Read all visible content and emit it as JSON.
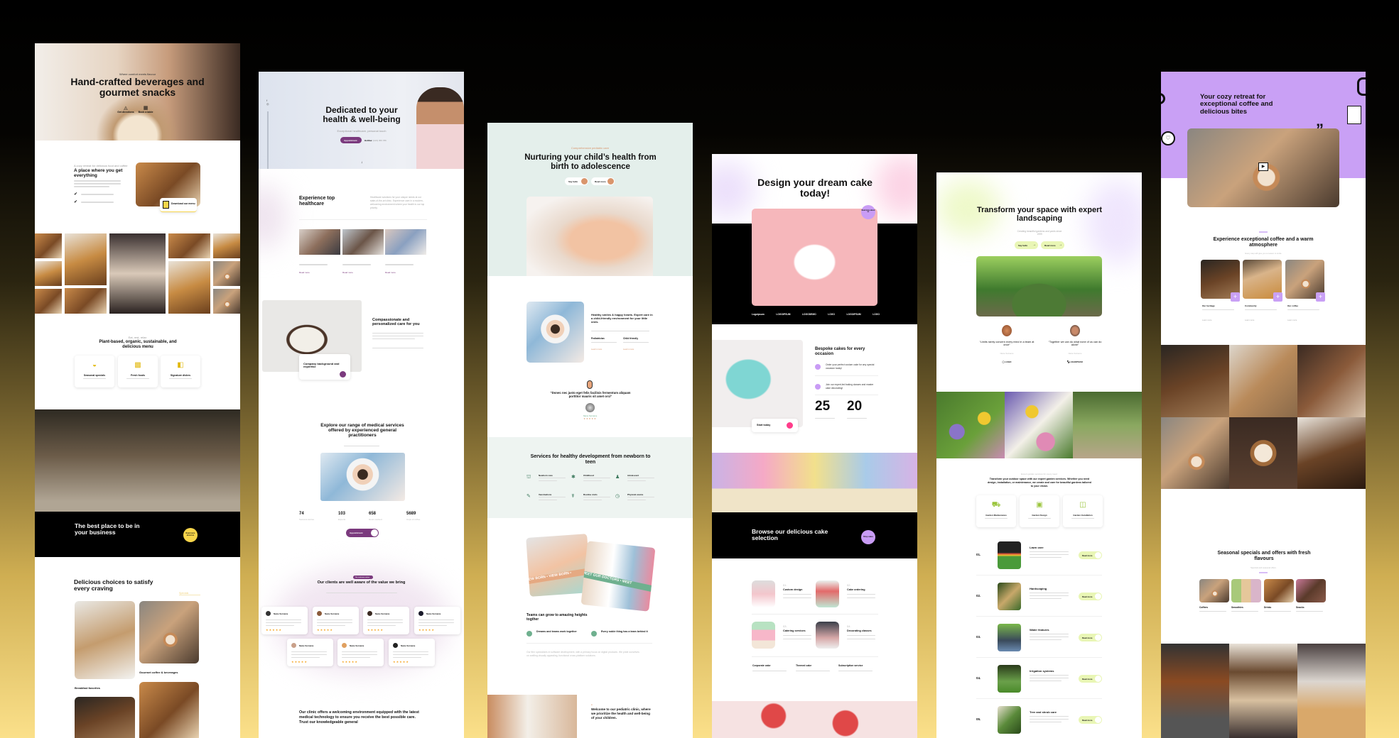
{
  "background": {
    "top_color": "#000000",
    "bottom_color": "#fbe08a"
  },
  "cafe": {
    "accent": "#f7d54a",
    "hero": {
      "eyebrow": "Where comfort meets flavour",
      "title_line1": "Hand-crafted beverages and",
      "title_line2": "gourmet snacks",
      "action1": "Get directions",
      "action2": "Book a table"
    },
    "about": {
      "eyebrow": "A cozy retreat for delicious food and coffee",
      "title": "A place where you get everything",
      "menu_card": "Download our menu"
    },
    "menu": {
      "eyebrow": "Eat, rest, relax",
      "title": "Plant-based, organic, sustainable, and delicious menu",
      "cards": [
        "Seasonal specials",
        "Fresh foods",
        "Signature dishes"
      ]
    },
    "band": {
      "title": "The best place to be in your business",
      "button": "Read more about us"
    },
    "choices": {
      "title": "Delicious choices to satisfy every craving",
      "link": "Specials",
      "items": [
        "Breakfast favorites",
        "Gourmet coffee & beverages"
      ]
    }
  },
  "clinic": {
    "accent": "#7b3a7e",
    "hero": {
      "title": "Dedicated to your health & well-being",
      "subtitle": "Exceptional healthcare, personal touch",
      "button": "Appointment",
      "hotline_label": "Hotline:",
      "hotline": "(123) 456 789"
    },
    "intro": {
      "title": "Experience top healthcare",
      "paragraph": "Healthcare solutions for your unique needs at our state-of-the-art clinic. Experience care in a modern, welcoming environment where your health is our top priority.",
      "read_more": "Read more"
    },
    "care": {
      "title": "Compassionate and personalized care for you",
      "card_title": "Company background and expertise"
    },
    "services": {
      "title": "Explore our range of medical services offered by experienced general practitioners",
      "stats": [
        {
          "value": "74",
          "label": "Success stories"
        },
        {
          "value": "103",
          "label": "Experts"
        },
        {
          "value": "658",
          "label": "Hours worked"
        },
        {
          "value": "5689",
          "label": "Cups of coffee"
        }
      ],
      "button": "Appointment"
    },
    "reviews": {
      "badge": "Our customer review",
      "title": "Our clients are well aware of the value we bring",
      "name": "Name Surname",
      "stars": "★★★★★"
    },
    "closing": "Our clinic offers a welcoming environment equipped with the latest medical technology to ensure you receive the best possible care. Trust our knowledgeable general"
  },
  "pediatric": {
    "accent": "#d9956c",
    "mint": "#e4efeb",
    "green": "#6fb08f",
    "hero": {
      "eyebrow": "Comprehensive pediatric care",
      "title": "Nurturing your child’s health from birth to adolescence",
      "button1": "Say hello",
      "button2": "Read more"
    },
    "about": {
      "title": "Healthy smiles & happy hearts. Expert care in a child-friendly environment for your little ones.",
      "feature1": "Pediatrician",
      "feature2": "Child friendly",
      "learn_more": "Learn more"
    },
    "quote": {
      "text": "“Donec nec justo eget felis facilisis fermentum aliquam porttitor mauris sit amet orci”",
      "name": "Name Surname",
      "stars": "★★★★★"
    },
    "services": {
      "title": "Services for healthy development from newborn to teen",
      "items": [
        "Newborn care",
        "Childhood",
        "Adolescent",
        "Vaccinations",
        "Routine visits",
        "Physical exams"
      ]
    },
    "team": {
      "banner1": "VIEW BORN • VIEW BORN •",
      "banner2": "MEET OUR DOCTORS • MEET",
      "title": "Teams can grow to amazing heights togther",
      "point1": "Dreams and teams work together",
      "point2": "Every noble thing has a team behind it",
      "paragraph": "Our firm specializes in software development, with a primary focus on digital products. We pride ourselves on crafting visually appealing, functional cross-platform solutions."
    },
    "welcome": "Welcome to our pediatric clinic, where we prioritize the health and well-being of your children."
  },
  "cakes": {
    "accent": "#c99cf5",
    "pink": "#ff3d8b",
    "hero": {
      "title": "Design your dream cake today!",
      "badge": "Read more about us",
      "logos": [
        "Logoipsum",
        "LOGOIPSUM",
        "LOGODEMO",
        "LOGO",
        "LOGOIPSUM",
        "LOGO"
      ]
    },
    "bespoke": {
      "title": "Bespoke cakes for every occasion",
      "item1": "Order your perfect custom cake for any special occasion today!",
      "item2": "Join our expert-led baking classes and master cake decorating!",
      "stat1": "25",
      "stat2": "20",
      "card": "Start today"
    },
    "band": {
      "title": "Browse our delicious cake selection",
      "button": "Shop cakes"
    },
    "services": [
      {
        "num": "01.",
        "title": "Custom design"
      },
      {
        "num": "02.",
        "title": "Cake ordering"
      },
      {
        "num": "03.",
        "title": "Catering services"
      },
      {
        "num": "04.",
        "title": "Decorating classes"
      }
    ],
    "extras": [
      "Corporate cake",
      "Themed cake",
      "Subscription service"
    ]
  },
  "landscaping": {
    "accent": "#e9f6b5",
    "hero": {
      "title": "Transform your space with expert landscaping",
      "subtitle": "Creating beautiful gardens and yards since 1999",
      "button1": "Say hello",
      "button2": "Read more"
    },
    "testimonials": [
      {
        "quote": "“Limits rarely concern every mind in a team at once”",
        "name": "Name Surname",
        "logo": "LOGO"
      },
      {
        "quote": "“Together we can do what none of us can do alone”",
        "name": "Name Surname",
        "logo": "LOGOIPSUM"
      }
    ],
    "services": {
      "eyebrow": "Expert garden services for every need",
      "paragraph": "Transform your outdoor space with our expert garden services. Whether you need design, installation, or maintenance, we create and care for beautiful gardens tailored to your vision.",
      "cards": [
        "Garden Maintenance",
        "Garden Design",
        "Garden Installation"
      ]
    },
    "list": [
      {
        "num": "01.",
        "title": "Lawn care"
      },
      {
        "num": "02.",
        "title": "Hardscaping"
      },
      {
        "num": "03.",
        "title": "Water features"
      },
      {
        "num": "04.",
        "title": "Irrigation systems"
      },
      {
        "num": "05.",
        "title": "Tree and shrub care"
      }
    ],
    "read_more": "Read more"
  },
  "coffee": {
    "accent": "#c9a0f5",
    "hero": {
      "title": "Your cozy retreat for exceptional coffee and delicious bites"
    },
    "experience": {
      "title": "Experience exceptional coffee and a warm atmosphere",
      "subtitle": "Every step will give you a reason to smile",
      "items": [
        "Our heritage",
        "Community",
        "Our coffee"
      ],
      "learn_more": "Learn more"
    },
    "specials": {
      "title": "Seasonal specials and offers with fresh flavours",
      "subtitle": "Specials and seasonal offers",
      "items": [
        "Coffees",
        "Smoothies",
        "Drinks",
        "Snacks"
      ]
    }
  }
}
